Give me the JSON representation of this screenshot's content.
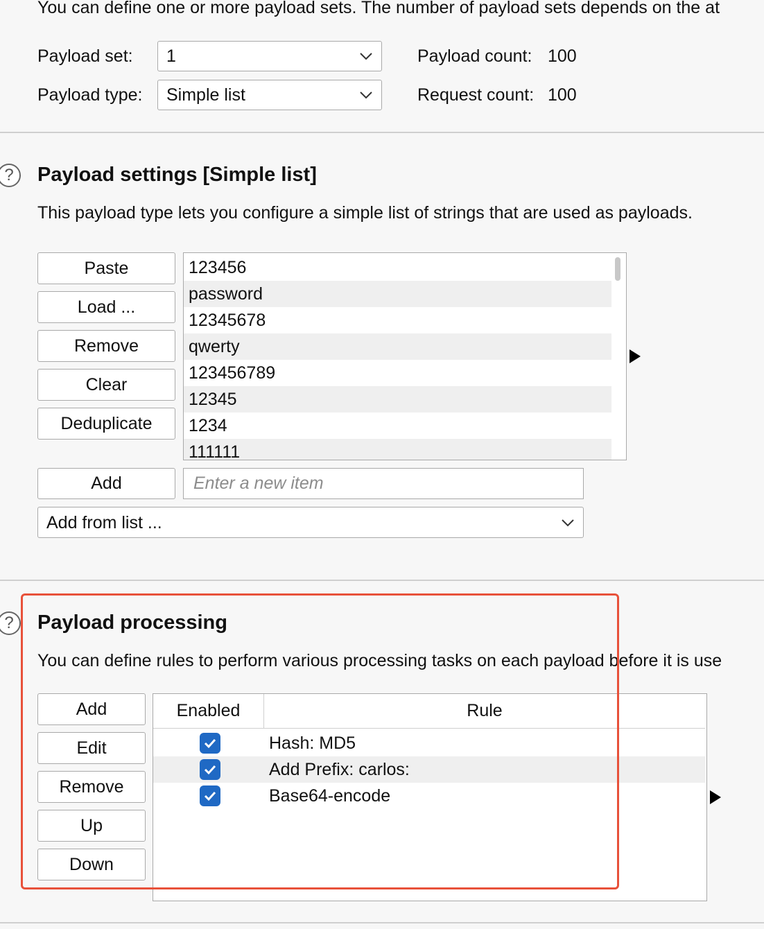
{
  "intro_text": "You can define one or more payload sets. The number of payload sets depends on the at",
  "payload_set": {
    "label": "Payload set:",
    "value": "1"
  },
  "payload_type": {
    "label": "Payload type:",
    "value": "Simple list"
  },
  "payload_count": {
    "label": "Payload count:",
    "value": "100"
  },
  "request_count": {
    "label": "Request count:",
    "value": "100"
  },
  "settings": {
    "help_glyph": "?",
    "title": "Payload settings [Simple list]",
    "description": "This payload type lets you configure a simple list of strings that are used as payloads.",
    "buttons": [
      "Paste",
      "Load ...",
      "Remove",
      "Clear",
      "Deduplicate"
    ],
    "items": [
      "123456",
      "password",
      "12345678",
      "qwerty",
      "123456789",
      "12345",
      "1234",
      "111111"
    ],
    "add_button": "Add",
    "add_placeholder": "Enter a new item",
    "add_from_list": "Add from list ..."
  },
  "processing": {
    "help_glyph": "?",
    "title": "Payload processing",
    "description": "You can define rules to perform various processing tasks on each payload before it is use",
    "buttons": [
      "Add",
      "Edit",
      "Remove",
      "Up",
      "Down"
    ],
    "columns": {
      "enabled": "Enabled",
      "rule": "Rule"
    },
    "rules": [
      {
        "enabled": true,
        "rule": "Hash: MD5"
      },
      {
        "enabled": true,
        "rule": "Add Prefix: carlos:"
      },
      {
        "enabled": true,
        "rule": "Base64-encode"
      }
    ]
  },
  "colors": {
    "checkbox": "#1f69c4",
    "highlight": "#e8513a"
  }
}
